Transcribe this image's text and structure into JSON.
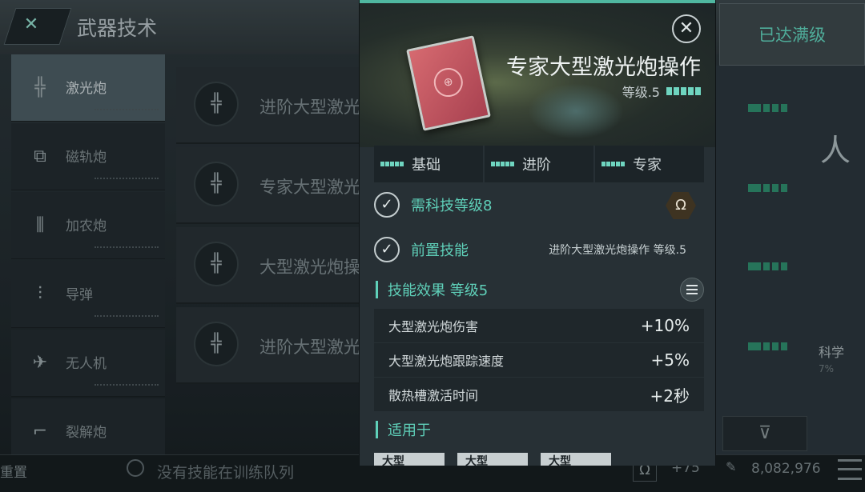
{
  "header": {
    "title": "武器技术",
    "maxed_label": "已达满级"
  },
  "sidebar": {
    "items": [
      {
        "label": "激光炮",
        "icon": "laser-icon",
        "active": true
      },
      {
        "label": "磁轨炮",
        "icon": "railgun-icon"
      },
      {
        "label": "加农炮",
        "icon": "cannon-icon"
      },
      {
        "label": "导弹",
        "icon": "missile-icon"
      },
      {
        "label": "无人机",
        "icon": "drone-icon"
      },
      {
        "label": "裂解炮",
        "icon": "disintegrator-icon"
      }
    ]
  },
  "list": {
    "items": [
      {
        "label": "进阶大型激光炮操作"
      },
      {
        "label": "专家大型激光炮操作"
      },
      {
        "label": "大型激光炮操作"
      },
      {
        "label": "进阶大型激光炮操作"
      }
    ]
  },
  "right_bg": {
    "char": "人",
    "science": "科学",
    "pct": "7%"
  },
  "bottom": {
    "reset": "重置",
    "queue": "没有技能在训练队列",
    "omega_plus": "+75",
    "isk": "8,082,976"
  },
  "modal": {
    "title": "专家大型激光炮操作",
    "level": "等级.5",
    "tabs": [
      {
        "label": "基础"
      },
      {
        "label": "进阶"
      },
      {
        "label": "专家"
      }
    ],
    "requirements": [
      {
        "label": "需科技等级8",
        "right": ""
      },
      {
        "label": "前置技能",
        "right": "进阶大型激光炮操作 等级.5"
      }
    ],
    "effects_title": "技能效果 等级5",
    "effects": [
      {
        "name": "大型激光炮伤害",
        "value": "+10%"
      },
      {
        "name": "大型激光炮跟踪速度",
        "value": "+5%"
      },
      {
        "name": "散热槽激活时间",
        "value": "+2秒"
      }
    ],
    "applies_title": "适用于",
    "applies": [
      {
        "label": "大型"
      },
      {
        "label": "大型"
      },
      {
        "label": "大型"
      }
    ]
  },
  "colors": {
    "accent": "#5fd0b9",
    "panel": "#273035"
  }
}
